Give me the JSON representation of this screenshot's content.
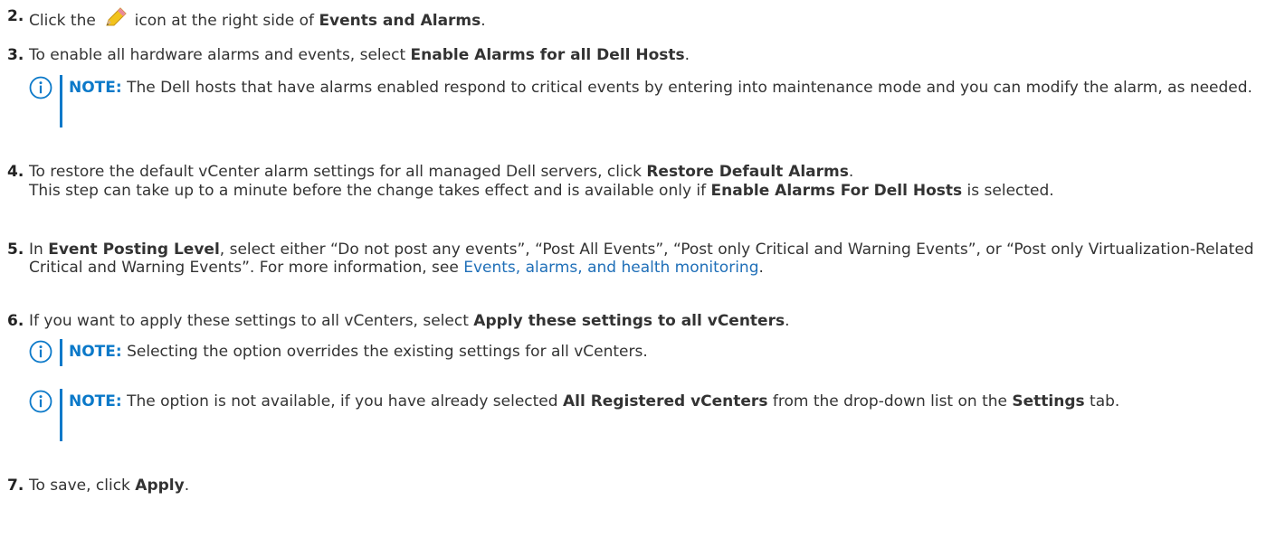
{
  "steps": [
    {
      "number": "2.",
      "before": "Click the ",
      "icon": "pencil-icon",
      "after_icon": " icon at the right side of ",
      "bold": "Events and Alarms",
      "end": "."
    },
    {
      "number": "3.",
      "before": "To enable all hardware alarms and events, select ",
      "bold": "Enable Alarms for all Dell Hosts",
      "end": "."
    },
    {
      "number": "4.",
      "before": "To restore the default vCenter alarm settings for all managed Dell servers, click ",
      "bold": "Restore Default Alarms",
      "end": ".",
      "extra_before": "This step can take up to a minute before the change takes effect and is available only if ",
      "extra_bold": "Enable Alarms For Dell Hosts",
      "extra_after": " is selected."
    },
    {
      "number": "5.",
      "before": "In ",
      "bold": "Event Posting Level",
      "middle": ", select either “Do not post any events”, “Post All Events”, “Post only Critical and Warning Events”, or “Post only Virtualization-Related Critical and Warning Events”. For more information, see ",
      "link": "Events, alarms, and health monitoring",
      "end": "."
    },
    {
      "number": "6.",
      "before": "If you want to apply these settings to all vCenters, select ",
      "bold": "Apply these settings to all vCenters",
      "end": "."
    },
    {
      "number": "7.",
      "before": "To save, click ",
      "bold": "Apply",
      "end": "."
    }
  ],
  "notes": [
    {
      "label": "NOTE:",
      "text": " The Dell hosts that have alarms enabled respond to critical events by entering into maintenance mode and you can modify the alarm, as needed."
    },
    {
      "label": "NOTE:",
      "text": " Selecting the option overrides the existing settings for all vCenters."
    },
    {
      "label": "NOTE:",
      "before": " The option is not available, if you have already selected ",
      "bold": "All Registered vCenters",
      "middle": " from the drop-down list on the ",
      "bold2": "Settings",
      "after": " tab."
    }
  ],
  "colors": {
    "note_accent": "#0b79c9",
    "link": "#1f6fb8",
    "text": "#333333"
  }
}
